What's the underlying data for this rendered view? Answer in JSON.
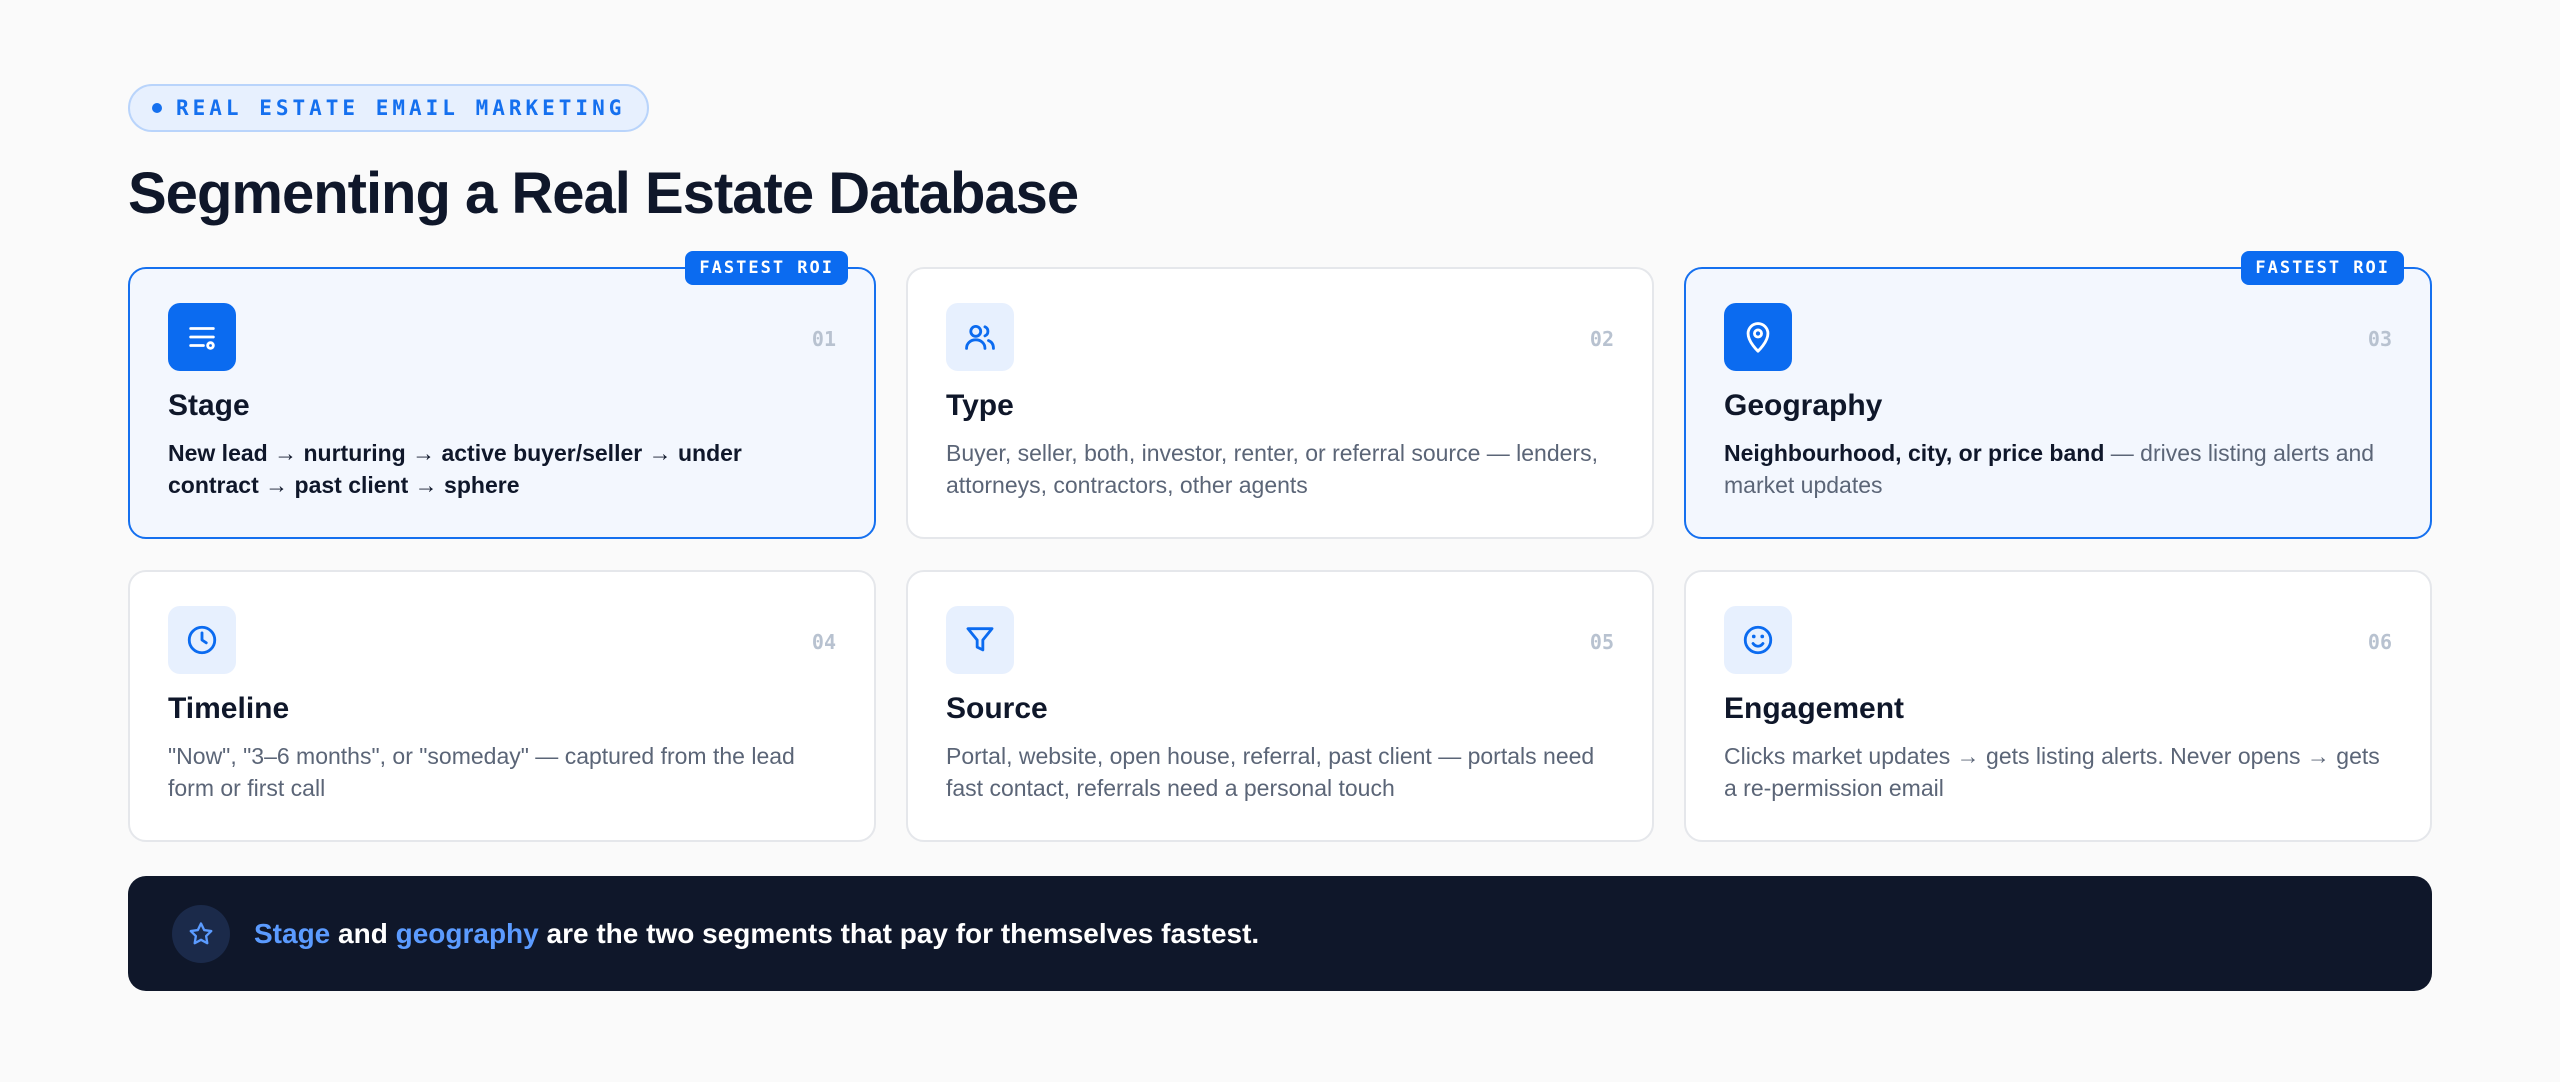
{
  "eyebrow": "REAL ESTATE EMAIL MARKETING",
  "title": "Segmenting a Real Estate Database",
  "badge_label": "FASTEST ROI",
  "cards": [
    {
      "num": "01",
      "icon": "list-filter-icon",
      "title": "Stage",
      "highlight": true,
      "desc_strong": "New lead → nurturing → active buyer/seller → under contract → past client → sphere",
      "desc": ""
    },
    {
      "num": "02",
      "icon": "users-icon",
      "title": "Type",
      "highlight": false,
      "desc_strong": "",
      "desc": "Buyer, seller, both, investor, renter, or referral source — lenders, attorneys, contractors, other agents"
    },
    {
      "num": "03",
      "icon": "map-pin-icon",
      "title": "Geography",
      "highlight": true,
      "desc_strong": "Neighbourhood, city, or price band",
      "desc": " — drives listing alerts and market updates"
    },
    {
      "num": "04",
      "icon": "clock-icon",
      "title": "Timeline",
      "highlight": false,
      "desc_strong": "",
      "desc": "\"Now\", \"3–6 months\", or \"someday\" — captured from the lead form or first call"
    },
    {
      "num": "05",
      "icon": "funnel-icon",
      "title": "Source",
      "highlight": false,
      "desc_strong": "",
      "desc": "Portal, website, open house, referral, past client — portals need fast contact, referrals need a personal touch"
    },
    {
      "num": "06",
      "icon": "smiley-icon",
      "title": "Engagement",
      "highlight": false,
      "desc_strong": "",
      "desc": "Clicks market updates → gets listing alerts. Never opens → gets a re-permission email"
    }
  ],
  "banner": {
    "icon": "star-icon",
    "accent1": "Stage",
    "mid": " and ",
    "accent2": "geography",
    "rest": " are the two segments that pay for themselves fastest."
  },
  "colors": {
    "accent": "#0b6bf0",
    "dark": "#0f172a",
    "accent_light": "#5b9bff"
  }
}
